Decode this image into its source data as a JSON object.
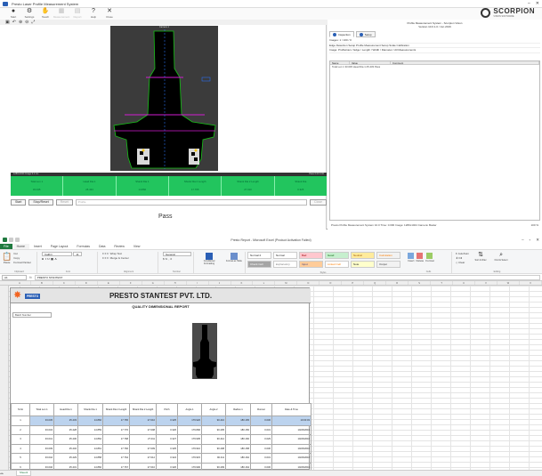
{
  "app1": {
    "title": "Presto Laser Profile Measurement System",
    "toolbar": [
      {
        "label": "Start",
        "glyph": "●",
        "dim": false
      },
      {
        "label": "Settings",
        "glyph": "⚙",
        "dim": false
      },
      {
        "label": "Teach",
        "glyph": "✋",
        "dim": false
      },
      {
        "label": "Measurement",
        "glyph": "▦",
        "dim": true
      },
      {
        "label": "Report",
        "glyph": "▤",
        "dim": true
      },
      {
        "label": "Help",
        "glyph": "?",
        "dim": false
      },
      {
        "label": "Close",
        "glyph": "✕",
        "dim": false
      }
    ],
    "sub_icons": [
      "▣",
      "↶",
      "⊕",
      "⊖",
      "⤢"
    ],
    "logo_name": "SCORPION",
    "logo_sub": "VISION SOFTWARE",
    "camera_label": "Camera 1",
    "info_left": "1280x1024 Image 0.1 ms",
    "info_right": "Pass 0.00 0.00",
    "results": [
      {
        "name": "Total Len 1",
        "value": "33.045"
      },
      {
        "name": "Head Dia 1",
        "value": "25.433"
      },
      {
        "name": "Shank Dia 1",
        "value": "14.860"
      },
      {
        "name": "Shank Dia 2 Length",
        "value": "17.765"
      },
      {
        "name": "Shank Dia 2 Length",
        "value": "27.010"
      },
      {
        "name": "Shank Dia",
        "value": "0.325"
      }
    ],
    "buttons": {
      "start": "Start",
      "stop": "Stop/Reset",
      "reset": "Reset",
      "close": "Close"
    },
    "field_value": "Profile",
    "status": "Pass",
    "right": {
      "header1": "Profile Measurement System - Scorpion Vision",
      "header2": "Version 10.0.1.0 / Jun 2016",
      "tab1": "Inspection",
      "tab2": "Setup",
      "line1": "Images: 1 / 100 / 0",
      "line2": "Edge Detection Setup Profile Measurement Setup Scale Calibration",
      "line3": "Image: ProfileCam / Edge / Length / Width / Diameter / All Measurements",
      "col1": "Name",
      "col2": "Value",
      "col3": "Comment",
      "row1": "Total Len 1   33.045   Head Dia 1   25.433   Pass",
      "status": "Presto Profile Measurement System 10.0  Time: 0.000  Image: 1280x1024  Camera: Basler",
      "zoom": "100 %"
    }
  },
  "excel": {
    "title": "Presto Report - Microsoft Excel (Product Activation Failed)",
    "menu": {
      "file": "File",
      "items": [
        "Home",
        "Insert",
        "Page Layout",
        "Formulas",
        "Data",
        "Review",
        "View"
      ]
    },
    "ribbon": {
      "paste": "Paste",
      "cut": "Cut",
      "copy": "Copy",
      "format_painter": "Format Painter",
      "clipboard": "Clipboard",
      "font_name": "Calibri",
      "font_size": "11",
      "font": "Font",
      "alignment": "Alignment",
      "wrap": "Wrap Text",
      "merge": "Merge & Center",
      "number": "Number",
      "number_format": "General",
      "cond_format": "Conditional Formatting",
      "format_table": "Format as Table",
      "styles_label": "Styles",
      "styles": [
        "Normal 2",
        "Normal",
        "Bad",
        "Good",
        "Neutral",
        "Calculation",
        "Check Cell",
        "Explanatory",
        "Input",
        "Linked Cell",
        "Note",
        "Output"
      ],
      "insert": "Insert",
      "delete": "Delete",
      "format": "Format",
      "cells": "Cells",
      "autosum": "AutoSum",
      "fill": "Fill",
      "clear": "Clear",
      "sort": "Sort & Filter",
      "find": "Find & Select",
      "editing": "Editing"
    },
    "name_box": "A1",
    "formula": "PRESTO STANTEST",
    "columns": [
      "A",
      "B",
      "C",
      "D",
      "E",
      "F",
      "G",
      "H",
      "I",
      "J",
      "K",
      "L",
      "M",
      "N",
      "O",
      "P",
      "Q",
      "R",
      "S",
      "T",
      "U",
      "V",
      "W",
      "X"
    ],
    "company": "PRESTO STANTEST PVT. LTD.",
    "logo_text": "PRESTO",
    "report_title": "QUALITY DIMENSIONAL REPORT",
    "meta": "Batch Number",
    "table": {
      "headers": [
        "S.No",
        "Total Len 1",
        "Head Dia 1",
        "Shank Dia 1",
        "Shank Dia 2 Length",
        "Shank Dia 2 Length",
        "Pitch",
        "Angle 1",
        "Angle 2",
        "Radius 1",
        "Runout",
        "Date & Time"
      ],
      "rows": [
        {
          "highlight": true,
          "cells": [
            "1",
            "33.045",
            "25.433",
            "14.860",
            "17.765",
            "27.010",
            "0.325",
            "179.920",
            "90.410",
            "180.165",
            "0.030",
            "10:00:03"
          ]
        },
        {
          "highlight": false,
          "cells": [
            "2",
            "33.034",
            "25.428",
            "14.859",
            "17.770",
            "27.008",
            "0.326",
            "179.890",
            "90.405",
            "180.150",
            "0.031",
            "10/20/2016"
          ]
        },
        {
          "highlight": false,
          "cells": [
            "3",
            "33.041",
            "25.430",
            "14.862",
            "17.768",
            "27.011",
            "0.327",
            "179.905",
            "90.412",
            "180.160",
            "0.029",
            "10/20/2016"
          ]
        },
        {
          "highlight": false,
          "cells": [
            "4",
            "33.039",
            "25.432",
            "14.861",
            "17.766",
            "27.009",
            "0.325",
            "179.910",
            "90.408",
            "180.158",
            "0.030",
            "10/20/2016"
          ]
        },
        {
          "highlight": false,
          "cells": [
            "5",
            "33.042",
            "25.429",
            "14.858",
            "17.764",
            "27.012",
            "0.324",
            "179.915",
            "90.411",
            "180.162",
            "0.031",
            "10/20/2016"
          ]
        },
        {
          "highlight": false,
          "cells": [
            "6",
            "33.040",
            "25.431",
            "14.860",
            "17.767",
            "27.010",
            "0.326",
            "179.900",
            "90.409",
            "180.164",
            "0.030",
            "10/20/2016"
          ]
        },
        {
          "highlight": false,
          "cells": [
            "7",
            "33.044",
            "25.433",
            "14.861",
            "17.765",
            "27.010",
            "0.325",
            "179.920",
            "90.410",
            "180.165",
            "0.030",
            "10/20/2016"
          ]
        }
      ],
      "empty_row": "8"
    },
    "sheet_tab": "Sheet1"
  }
}
